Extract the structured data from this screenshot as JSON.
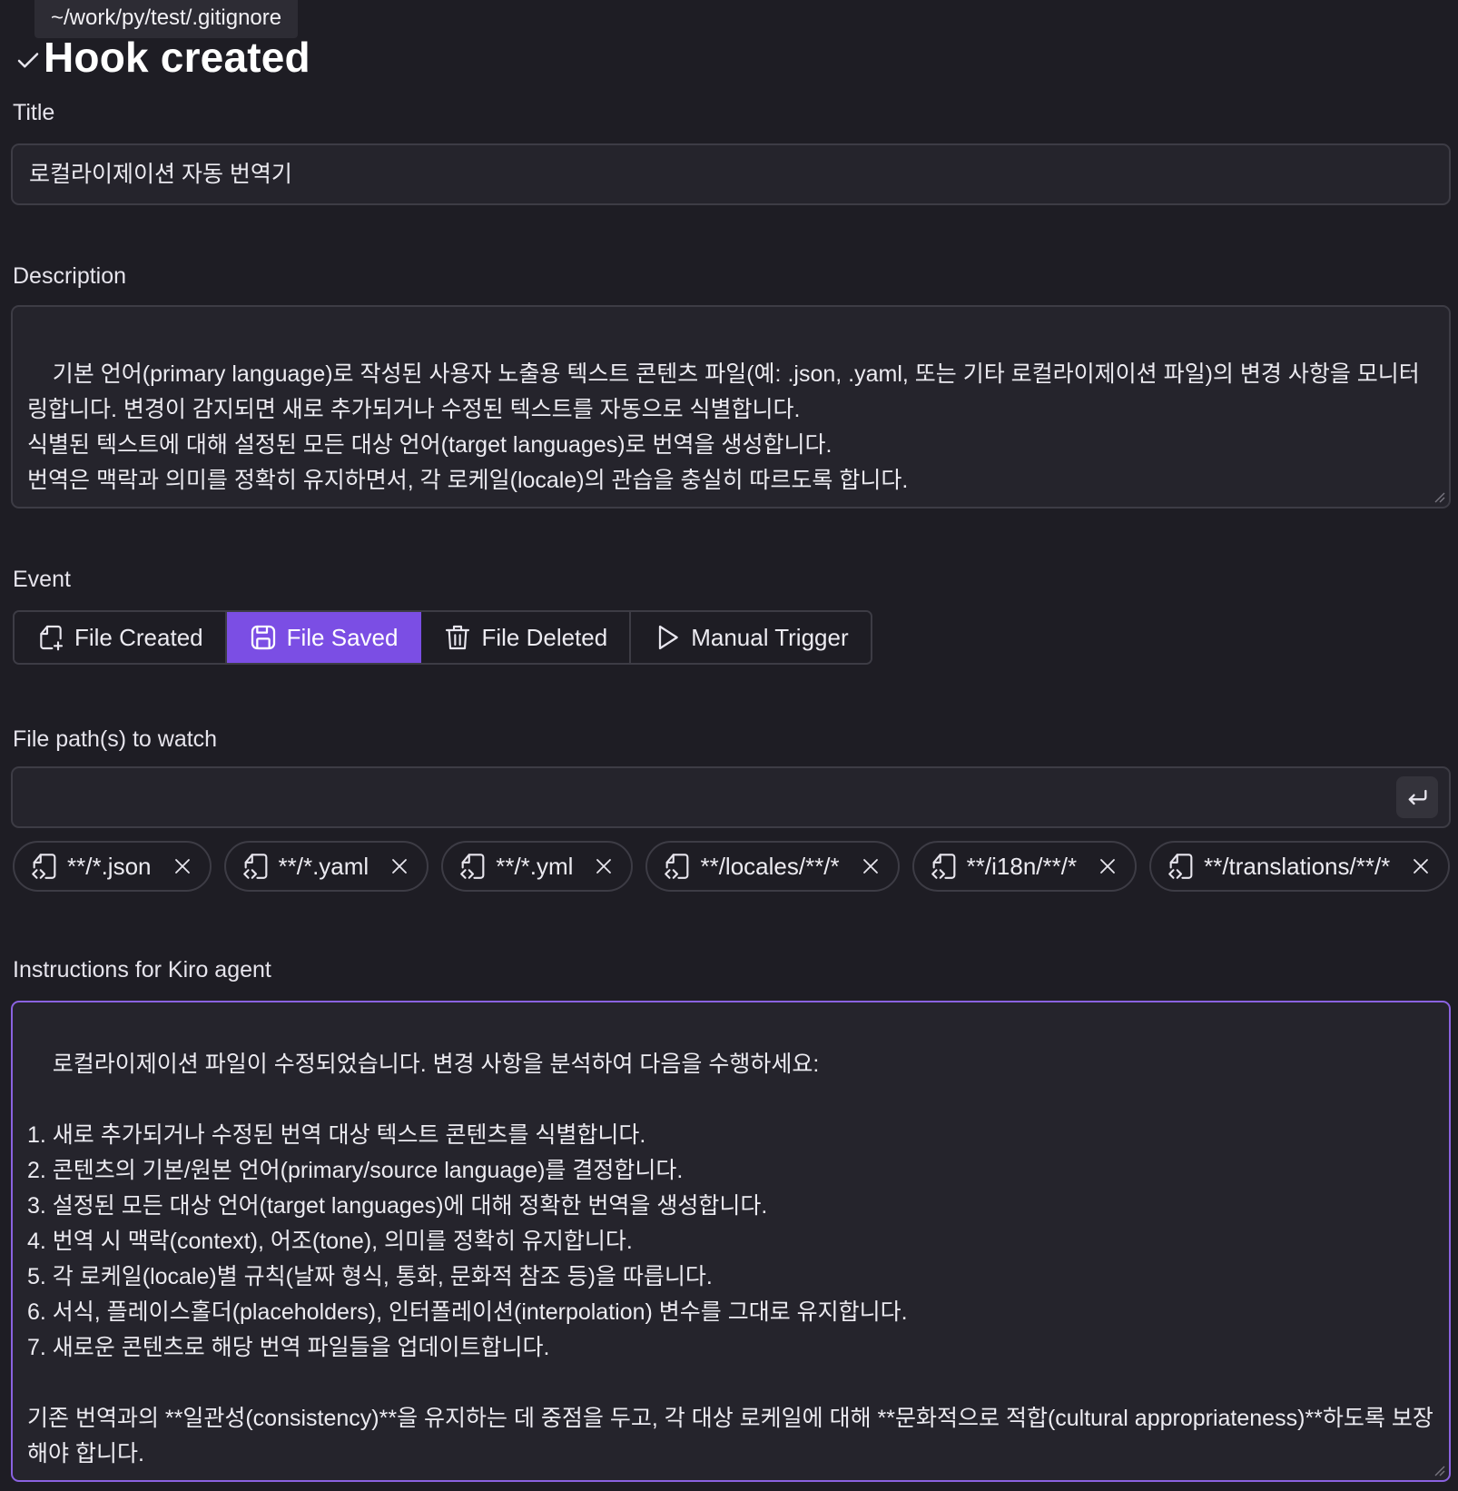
{
  "tooltip": "~/work/py/test/.gitignore",
  "heading": {
    "title": "Hook created",
    "icon": "check-icon"
  },
  "form": {
    "title_label": "Title",
    "title_value": "로컬라이제이션 자동 번역기",
    "description_label": "Description",
    "description_value": "기본 언어(primary language)로 작성된 사용자 노출용 텍스트 콘텐츠 파일(예: .json, .yaml, 또는 기타 로컬라이제이션 파일)의 변경 사항을 모니터링합니다. 변경이 감지되면 새로 추가되거나 수정된 텍스트를 자동으로 식별합니다.\n식별된 텍스트에 대해 설정된 모든 대상 언어(target languages)로 번역을 생성합니다.\n번역은 맥락과 의미를 정확히 유지하면서, 각 로케일(locale)의 관습을 충실히 따르도록 합니다.",
    "event_label": "Event",
    "events": [
      {
        "label": "File Created",
        "icon": "file-plus-icon",
        "active": false
      },
      {
        "label": "File Saved",
        "icon": "save-icon",
        "active": true
      },
      {
        "label": "File Deleted",
        "icon": "trash-icon",
        "active": false
      },
      {
        "label": "Manual Trigger",
        "icon": "play-icon",
        "active": false
      }
    ],
    "paths_label": "File path(s) to watch",
    "paths_input_value": "",
    "paths": [
      "**/*.json",
      "**/*.yaml",
      "**/*.yml",
      "**/locales/**/*",
      "**/i18n/**/*",
      "**/translations/**/*"
    ],
    "instructions_label": "Instructions for Kiro agent",
    "instructions_value": "로컬라이제이션 파일이 수정되었습니다. 변경 사항을 분석하여 다음을 수행하세요:\n\n1. 새로 추가되거나 수정된 번역 대상 텍스트 콘텐츠를 식별합니다.\n2. 콘텐츠의 기본/원본 언어(primary/source language)를 결정합니다.\n3. 설정된 모든 대상 언어(target languages)에 대해 정확한 번역을 생성합니다.\n4. 번역 시 맥락(context), 어조(tone), 의미를 정확히 유지합니다.\n5. 각 로케일(locale)별 규칙(날짜 형식, 통화, 문화적 참조 등)을 따릅니다.\n6. 서식, 플레이스홀더(placeholders), 인터폴레이션(interpolation) 변수를 그대로 유지합니다.\n7. 새로운 콘텐츠로 해당 번역 파일들을 업데이트합니다.\n\n기존 번역과의 **일관성(consistency)**을 유지하는 데 중점을 두고, 각 대상 로케일에 대해 **문화적으로 적합(cultural appropriateness)**하도록 보장해야 합니다."
  },
  "colors": {
    "background": "#1e1d24",
    "field_bg": "#25242c",
    "border": "#3d3c45",
    "accent": "#7b4ee4",
    "focus_border": "#8a62e0"
  }
}
